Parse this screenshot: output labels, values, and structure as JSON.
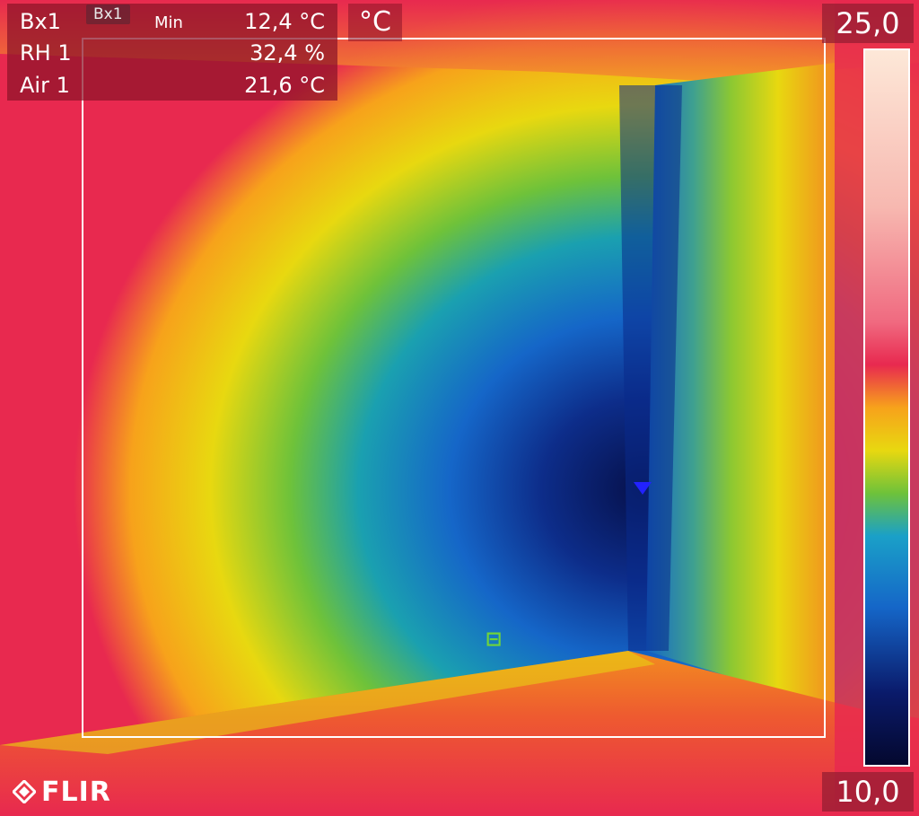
{
  "overlay": {
    "rows": [
      {
        "label": "Bx1",
        "sub": "Min",
        "value": "12,4 °C"
      },
      {
        "label": "RH 1",
        "value": "32,4 %"
      },
      {
        "label": "Air 1",
        "value": "21,6 °C"
      }
    ],
    "box_tag": "Bx1",
    "unit": "°C"
  },
  "scale": {
    "max": "25,0",
    "min": "10,0"
  },
  "brand": {
    "logo_text": "FLIR"
  },
  "colors": {
    "hot": "#e8294f",
    "warm": "#f7a21b",
    "mid": "#e8d810",
    "cool_green": "#6ec23a",
    "cool_blue": "#1566c8",
    "cold": "#06104a"
  }
}
